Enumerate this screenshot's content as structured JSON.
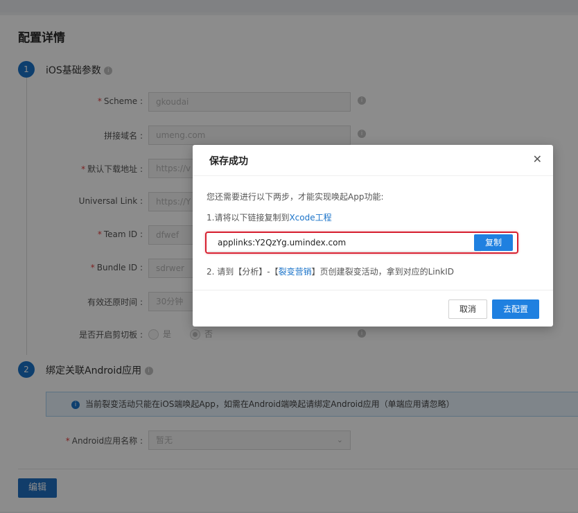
{
  "page": {
    "title": "配置详情"
  },
  "ios_section": {
    "step": "1",
    "title": "iOS基础参数",
    "fields": [
      {
        "label": "Scheme",
        "required": "*",
        "value": "gkoudai"
      },
      {
        "label": "拼接域名",
        "required": "",
        "value": "umeng.com"
      },
      {
        "label": "默认下载地址",
        "required": "*",
        "value": "https://v"
      },
      {
        "label": "Universal Link",
        "required": "",
        "value": "https://Y"
      },
      {
        "label": "Team ID",
        "required": "*",
        "value": "dfwef"
      },
      {
        "label": "Bundle ID",
        "required": "*",
        "value": "sdrwer"
      },
      {
        "label": "有效还原时间",
        "required": "",
        "value": "30分钟"
      }
    ],
    "clipboard_label": "是否开启剪切板",
    "radio_yes": "是",
    "radio_no": "否"
  },
  "android_section": {
    "step": "2",
    "title": "绑定关联Android应用",
    "notice": "当前裂变活动只能在iOS端唤起App，如需在Android端唤起请绑定Android应用（单端应用请忽略）",
    "app_name_label": "Android应用名称",
    "app_name_placeholder": "暂无"
  },
  "edit_button": "编辑",
  "modal": {
    "title": "保存成功",
    "intro": "您还需要进行以下两步，才能实现唤起App功能:",
    "step1_prefix": "1.请将以下链接复制到",
    "step1_link": "Xcode工程",
    "copy_value": "applinks:Y2QzYg.umindex.com",
    "copy_button": "复制",
    "step2_prefix": "2. 请到【分析】-【",
    "step2_link": "裂变营销",
    "step2_suffix": "】页创建裂变活动，拿到对应的LinkID",
    "cancel": "取消",
    "confirm": "去配置"
  }
}
